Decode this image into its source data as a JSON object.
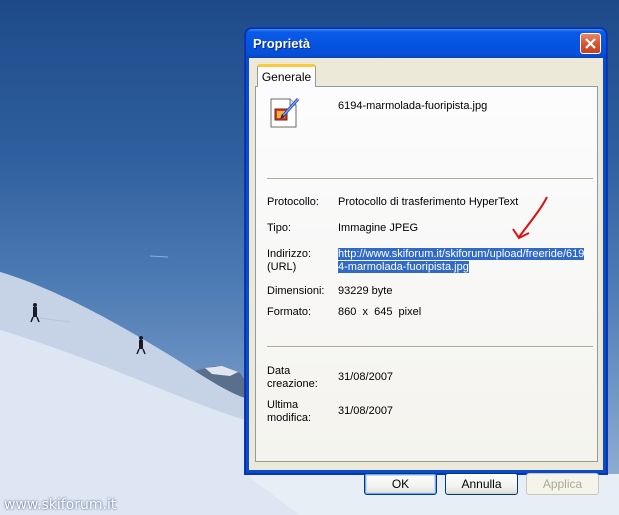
{
  "window": {
    "title": "Proprietà",
    "tab_label": "Generale"
  },
  "file": {
    "name": "6194-marmolada-fuoripista.jpg",
    "icon": "jpeg-image-file-icon"
  },
  "properties": {
    "protocol_label": "Protocollo:",
    "protocol_value": "Protocollo di trasferimento HyperText",
    "type_label": "Tipo:",
    "type_value": "Immagine JPEG",
    "address_label_1": "Indirizzo:",
    "address_label_2": "(URL)",
    "address_value": "http://www.skiforum.it/skiforum/upload/freeride/6194-marmolada-fuoripista.jpg",
    "size_label": "Dimensioni:",
    "size_value": "93229 byte",
    "format_label": "Formato:",
    "format_value": "860  x  645  pixel",
    "created_label_1": "Data",
    "created_label_2": "creazione:",
    "created_value": "31/08/2007",
    "modified_label_1": "Ultima",
    "modified_label_2": "modifica:",
    "modified_value": "31/08/2007"
  },
  "buttons": {
    "ok": "OK",
    "cancel": "Annulla",
    "apply": "Applica"
  },
  "watermark": "www.skiforum.it",
  "colors": {
    "titlebar": "#0554e2",
    "selection": "#316ac5",
    "annotation_arrow": "#e01010",
    "tab_highlight": "#ffc83c"
  }
}
